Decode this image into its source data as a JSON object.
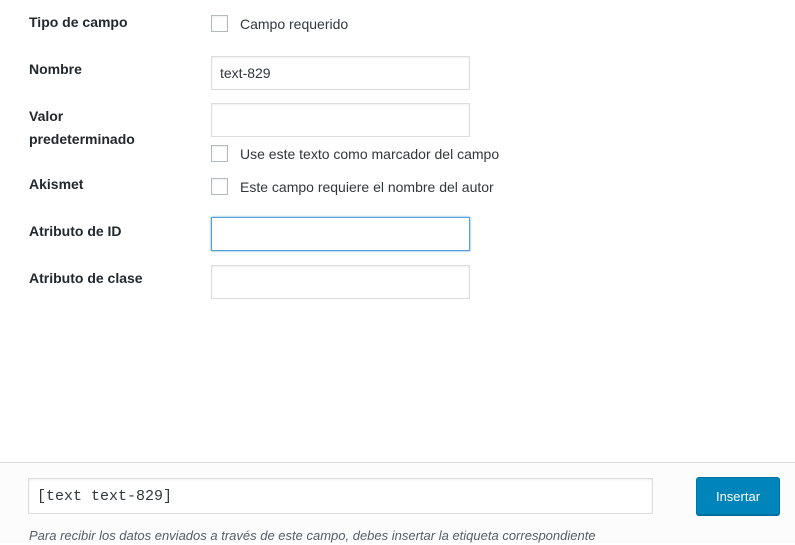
{
  "form": {
    "field_type_label": "Tipo de campo",
    "required_label": "Campo requerido",
    "name_label": "Nombre",
    "name_value": "text-829",
    "default_label_line1": "Valor",
    "default_label_line2": "predeterminado",
    "default_value": "",
    "placeholder_option_label": "Use este texto como marcador del campo",
    "akismet_label": "Akismet",
    "akismet_option_label": "Este campo requiere el nombre del autor",
    "id_label": "Atributo de ID",
    "id_value": "",
    "class_label": "Atributo de clase",
    "class_value": ""
  },
  "footer": {
    "tag_value": "[text text-829]",
    "insert_label": "Insertar",
    "note": "Para recibir los datos enviados a través de este campo, debes insertar la etiqueta correspondiente"
  },
  "colors": {
    "accent": "#0085ba",
    "focus_border": "#5b9dd9"
  }
}
